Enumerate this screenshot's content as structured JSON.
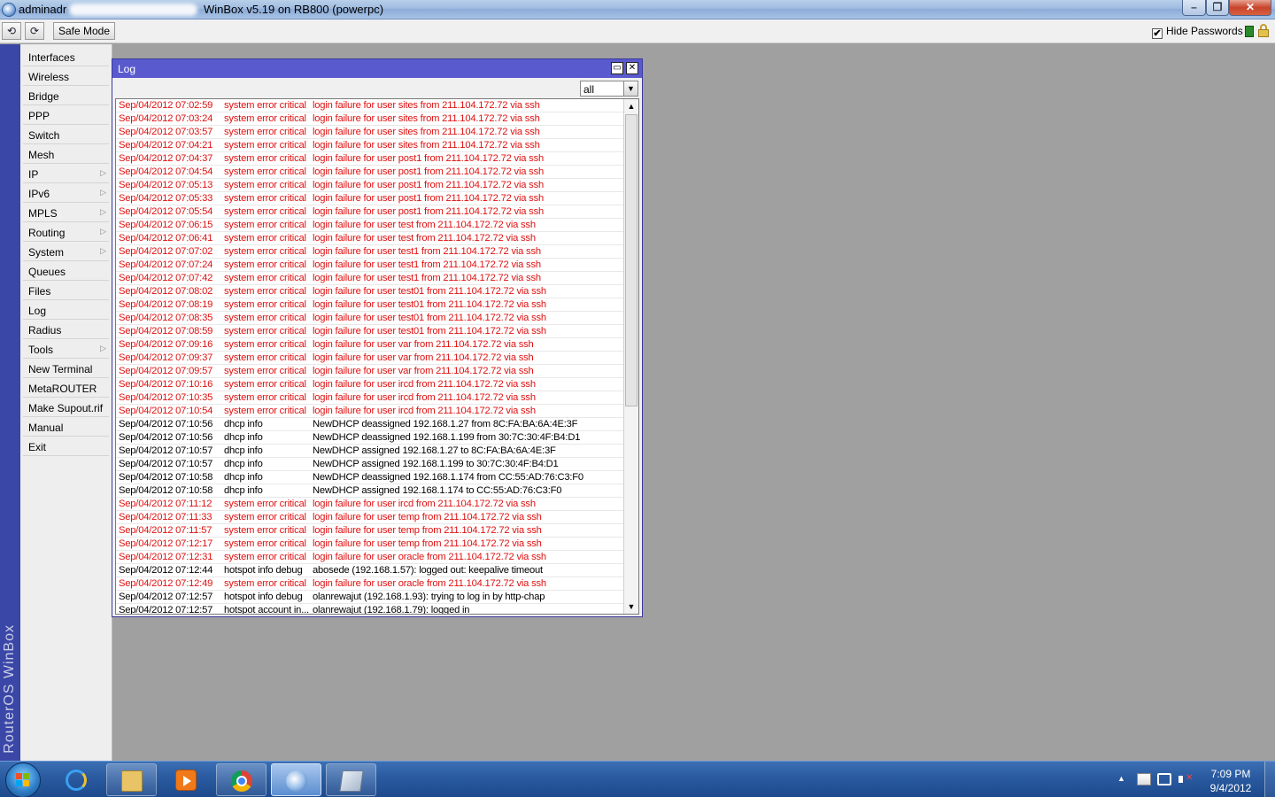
{
  "titlebar": {
    "user_prefix": "adminadr",
    "host_title": "WinBox v5.19 on RB800 (powerpc)",
    "min_icon": "minimize-icon",
    "max_icon": "maximize-icon",
    "close_icon": "close-icon"
  },
  "toolbar": {
    "undo_glyph": "⟲",
    "redo_glyph": "⟳",
    "safe_mode_label": "Safe Mode",
    "hide_passwords_label": "Hide Passwords",
    "hide_passwords_checked": "✔",
    "indicator_color": "#2a8a2a"
  },
  "brand": {
    "text": "RouterOS WinBox"
  },
  "sidebar": {
    "items": [
      {
        "label": "Interfaces",
        "has_submenu": false
      },
      {
        "label": "Wireless",
        "has_submenu": false
      },
      {
        "label": "Bridge",
        "has_submenu": false
      },
      {
        "label": "PPP",
        "has_submenu": false
      },
      {
        "label": "Switch",
        "has_submenu": false
      },
      {
        "label": "Mesh",
        "has_submenu": false
      },
      {
        "label": "IP",
        "has_submenu": true
      },
      {
        "label": "IPv6",
        "has_submenu": true
      },
      {
        "label": "MPLS",
        "has_submenu": true
      },
      {
        "label": "Routing",
        "has_submenu": true
      },
      {
        "label": "System",
        "has_submenu": true
      },
      {
        "label": "Queues",
        "has_submenu": false
      },
      {
        "label": "Files",
        "has_submenu": false
      },
      {
        "label": "Log",
        "has_submenu": false
      },
      {
        "label": "Radius",
        "has_submenu": false
      },
      {
        "label": "Tools",
        "has_submenu": true
      },
      {
        "label": "New Terminal",
        "has_submenu": false
      },
      {
        "label": "MetaROUTER",
        "has_submenu": false
      },
      {
        "label": "Make Supout.rif",
        "has_submenu": false
      },
      {
        "label": "Manual",
        "has_submenu": false
      },
      {
        "label": "Exit",
        "has_submenu": false
      }
    ]
  },
  "log_window": {
    "title": "Log",
    "filter_value": "all",
    "colors": {
      "error": "#e01010",
      "normal": "#000000",
      "title_bar": "#5a5acf"
    },
    "rows": [
      {
        "time": "Sep/04/2012 07:02:59",
        "topic": "system error critical",
        "message": "login failure for user sites from 211.104.172.72 via ssh",
        "level": "error"
      },
      {
        "time": "Sep/04/2012 07:03:24",
        "topic": "system error critical",
        "message": "login failure for user sites from 211.104.172.72 via ssh",
        "level": "error"
      },
      {
        "time": "Sep/04/2012 07:03:57",
        "topic": "system error critical",
        "message": "login failure for user sites from 211.104.172.72 via ssh",
        "level": "error"
      },
      {
        "time": "Sep/04/2012 07:04:21",
        "topic": "system error critical",
        "message": "login failure for user sites from 211.104.172.72 via ssh",
        "level": "error"
      },
      {
        "time": "Sep/04/2012 07:04:37",
        "topic": "system error critical",
        "message": "login failure for user post1 from 211.104.172.72 via ssh",
        "level": "error"
      },
      {
        "time": "Sep/04/2012 07:04:54",
        "topic": "system error critical",
        "message": "login failure for user post1 from 211.104.172.72 via ssh",
        "level": "error"
      },
      {
        "time": "Sep/04/2012 07:05:13",
        "topic": "system error critical",
        "message": "login failure for user post1 from 211.104.172.72 via ssh",
        "level": "error"
      },
      {
        "time": "Sep/04/2012 07:05:33",
        "topic": "system error critical",
        "message": "login failure for user post1 from 211.104.172.72 via ssh",
        "level": "error"
      },
      {
        "time": "Sep/04/2012 07:05:54",
        "topic": "system error critical",
        "message": "login failure for user post1 from 211.104.172.72 via ssh",
        "level": "error"
      },
      {
        "time": "Sep/04/2012 07:06:15",
        "topic": "system error critical",
        "message": "login failure for user test from 211.104.172.72 via ssh",
        "level": "error"
      },
      {
        "time": "Sep/04/2012 07:06:41",
        "topic": "system error critical",
        "message": "login failure for user test from 211.104.172.72 via ssh",
        "level": "error"
      },
      {
        "time": "Sep/04/2012 07:07:02",
        "topic": "system error critical",
        "message": "login failure for user test1 from 211.104.172.72 via ssh",
        "level": "error"
      },
      {
        "time": "Sep/04/2012 07:07:24",
        "topic": "system error critical",
        "message": "login failure for user test1 from 211.104.172.72 via ssh",
        "level": "error"
      },
      {
        "time": "Sep/04/2012 07:07:42",
        "topic": "system error critical",
        "message": "login failure for user test1 from 211.104.172.72 via ssh",
        "level": "error"
      },
      {
        "time": "Sep/04/2012 07:08:02",
        "topic": "system error critical",
        "message": "login failure for user test01 from 211.104.172.72 via ssh",
        "level": "error"
      },
      {
        "time": "Sep/04/2012 07:08:19",
        "topic": "system error critical",
        "message": "login failure for user test01 from 211.104.172.72 via ssh",
        "level": "error"
      },
      {
        "time": "Sep/04/2012 07:08:35",
        "topic": "system error critical",
        "message": "login failure for user test01 from 211.104.172.72 via ssh",
        "level": "error"
      },
      {
        "time": "Sep/04/2012 07:08:59",
        "topic": "system error critical",
        "message": "login failure for user test01 from 211.104.172.72 via ssh",
        "level": "error"
      },
      {
        "time": "Sep/04/2012 07:09:16",
        "topic": "system error critical",
        "message": "login failure for user var from 211.104.172.72 via ssh",
        "level": "error"
      },
      {
        "time": "Sep/04/2012 07:09:37",
        "topic": "system error critical",
        "message": "login failure for user var from 211.104.172.72 via ssh",
        "level": "error"
      },
      {
        "time": "Sep/04/2012 07:09:57",
        "topic": "system error critical",
        "message": "login failure for user var from 211.104.172.72 via ssh",
        "level": "error"
      },
      {
        "time": "Sep/04/2012 07:10:16",
        "topic": "system error critical",
        "message": "login failure for user ircd from 211.104.172.72 via ssh",
        "level": "error"
      },
      {
        "time": "Sep/04/2012 07:10:35",
        "topic": "system error critical",
        "message": "login failure for user ircd from 211.104.172.72 via ssh",
        "level": "error"
      },
      {
        "time": "Sep/04/2012 07:10:54",
        "topic": "system error critical",
        "message": "login failure for user ircd from 211.104.172.72 via ssh",
        "level": "error"
      },
      {
        "time": "Sep/04/2012 07:10:56",
        "topic": "dhcp info",
        "message": "NewDHCP deassigned 192.168.1.27 from 8C:FA:BA:6A:4E:3F",
        "level": "info"
      },
      {
        "time": "Sep/04/2012 07:10:56",
        "topic": "dhcp info",
        "message": "NewDHCP deassigned 192.168.1.199 from 30:7C:30:4F:B4:D1",
        "level": "info"
      },
      {
        "time": "Sep/04/2012 07:10:57",
        "topic": "dhcp info",
        "message": "NewDHCP assigned 192.168.1.27 to 8C:FA:BA:6A:4E:3F",
        "level": "info"
      },
      {
        "time": "Sep/04/2012 07:10:57",
        "topic": "dhcp info",
        "message": "NewDHCP assigned 192.168.1.199 to 30:7C:30:4F:B4:D1",
        "level": "info"
      },
      {
        "time": "Sep/04/2012 07:10:58",
        "topic": "dhcp info",
        "message": "NewDHCP deassigned 192.168.1.174 from CC:55:AD:76:C3:F0",
        "level": "info"
      },
      {
        "time": "Sep/04/2012 07:10:58",
        "topic": "dhcp info",
        "message": "NewDHCP assigned 192.168.1.174 to CC:55:AD:76:C3:F0",
        "level": "info"
      },
      {
        "time": "Sep/04/2012 07:11:12",
        "topic": "system error critical",
        "message": "login failure for user ircd from 211.104.172.72 via ssh",
        "level": "error"
      },
      {
        "time": "Sep/04/2012 07:11:33",
        "topic": "system error critical",
        "message": "login failure for user temp from 211.104.172.72 via ssh",
        "level": "error"
      },
      {
        "time": "Sep/04/2012 07:11:57",
        "topic": "system error critical",
        "message": "login failure for user temp from 211.104.172.72 via ssh",
        "level": "error"
      },
      {
        "time": "Sep/04/2012 07:12:17",
        "topic": "system error critical",
        "message": "login failure for user temp from 211.104.172.72 via ssh",
        "level": "error"
      },
      {
        "time": "Sep/04/2012 07:12:31",
        "topic": "system error critical",
        "message": "login failure for user oracle from 211.104.172.72 via ssh",
        "level": "error"
      },
      {
        "time": "Sep/04/2012 07:12:44",
        "topic": "hotspot info debug",
        "message": "abosede (192.168.1.57): logged out: keepalive timeout",
        "level": "info"
      },
      {
        "time": "Sep/04/2012 07:12:49",
        "topic": "system error critical",
        "message": "login failure for user oracle from 211.104.172.72 via ssh",
        "level": "error"
      },
      {
        "time": "Sep/04/2012 07:12:57",
        "topic": "hotspot info debug",
        "message": "olanrewajut (192.168.1.93): trying to log in by http-chap",
        "level": "info"
      },
      {
        "time": "Sep/04/2012 07:12:57",
        "topic": "hotspot account in...",
        "message": "olanrewajut (192.168.1.79): logged in",
        "level": "info"
      }
    ]
  },
  "taskbar": {
    "apps": [
      {
        "name": "internet-explorer",
        "state": "pinned"
      },
      {
        "name": "file-explorer",
        "state": "open"
      },
      {
        "name": "media-player",
        "state": "pinned"
      },
      {
        "name": "chrome",
        "state": "open"
      },
      {
        "name": "winbox",
        "state": "active"
      },
      {
        "name": "notepad",
        "state": "open"
      }
    ],
    "clock_time": "7:09 PM",
    "clock_date": "9/4/2012"
  }
}
